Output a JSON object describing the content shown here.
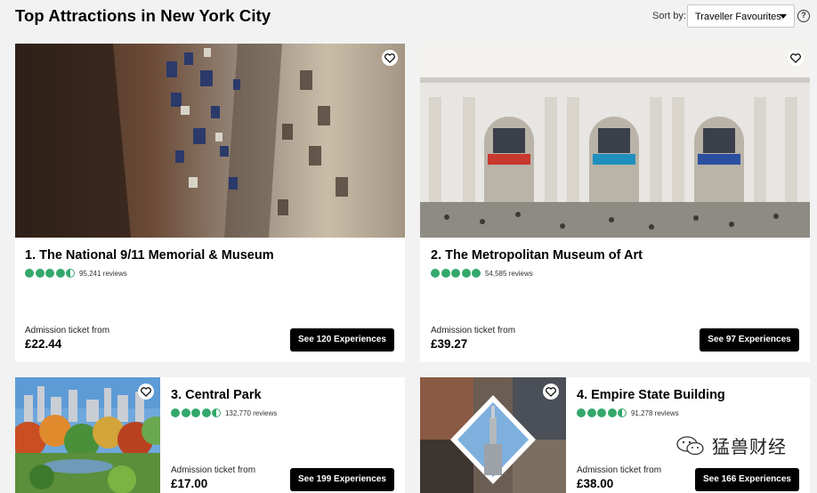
{
  "header": {
    "title": "Top Attractions in New York City",
    "sort_label": "Sort by:",
    "sort_value": "Traveller Favourites"
  },
  "colors": {
    "rating": "#34a86c",
    "button": "#000000",
    "background": "#f2f2f2"
  },
  "attractions": [
    {
      "title": "1. The National 9/11 Memorial & Museum",
      "rating": 4.5,
      "reviews": "95,241 reviews",
      "admission_label": "Admission ticket from",
      "price": "£22.44",
      "button": "See 120 Experiences"
    },
    {
      "title": "2. The Metropolitan Museum of Art",
      "rating": 5,
      "reviews": "54,585 reviews",
      "admission_label": "Admission ticket from",
      "price": "£39.27",
      "button": "See 97 Experiences"
    },
    {
      "title": "3. Central Park",
      "rating": 4.5,
      "reviews": "132,770 reviews",
      "admission_label": "Admission ticket from",
      "price": "£17.00",
      "button": "See 199 Experiences"
    },
    {
      "title": "4. Empire State Building",
      "rating": 4.5,
      "reviews": "91,278 reviews",
      "admission_label": "Admission ticket from",
      "price": "£38.00",
      "button": "See 166 Experiences"
    }
  ],
  "watermark": {
    "text": "猛兽财经"
  }
}
